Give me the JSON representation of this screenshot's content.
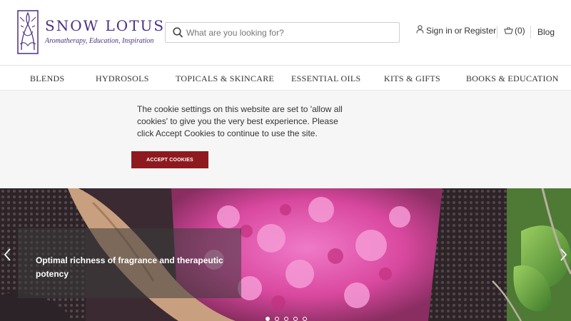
{
  "brand": {
    "name": "SNOW LOTUS",
    "tagline": "Aromatherapy, Education, Inspiration",
    "color": "#4a2f86"
  },
  "search": {
    "placeholder": "What are you looking for?",
    "icon": "search-icon"
  },
  "account": {
    "sign_in": "Sign in",
    "or": "or",
    "register": "Register",
    "icon": "user-icon"
  },
  "cart": {
    "count_label": "(0)",
    "icon": "basket-icon"
  },
  "blog_label": "Blog",
  "nav": {
    "items": [
      {
        "label": "BLENDS"
      },
      {
        "label": "HYDROSOLS"
      },
      {
        "label": "TOPICALS & SKINCARE"
      },
      {
        "label": "ESSENTIAL OILS"
      },
      {
        "label": "KITS & GIFTS"
      },
      {
        "label": "BOOKS & EDUCATION"
      }
    ]
  },
  "cookie": {
    "message": "The cookie settings on this website are set to 'allow all cookies' to give you the very best experience. Please click Accept Cookies to continue to use the site.",
    "button_label": "ACCEPT COOKIES",
    "button_color": "#8e1a1f"
  },
  "hero": {
    "caption": "Optimal richness of fragrance and therapeutic potency",
    "slides_total": 5,
    "active_slide": 1,
    "prev_icon": "chevron-left-icon",
    "next_icon": "chevron-right-icon"
  }
}
